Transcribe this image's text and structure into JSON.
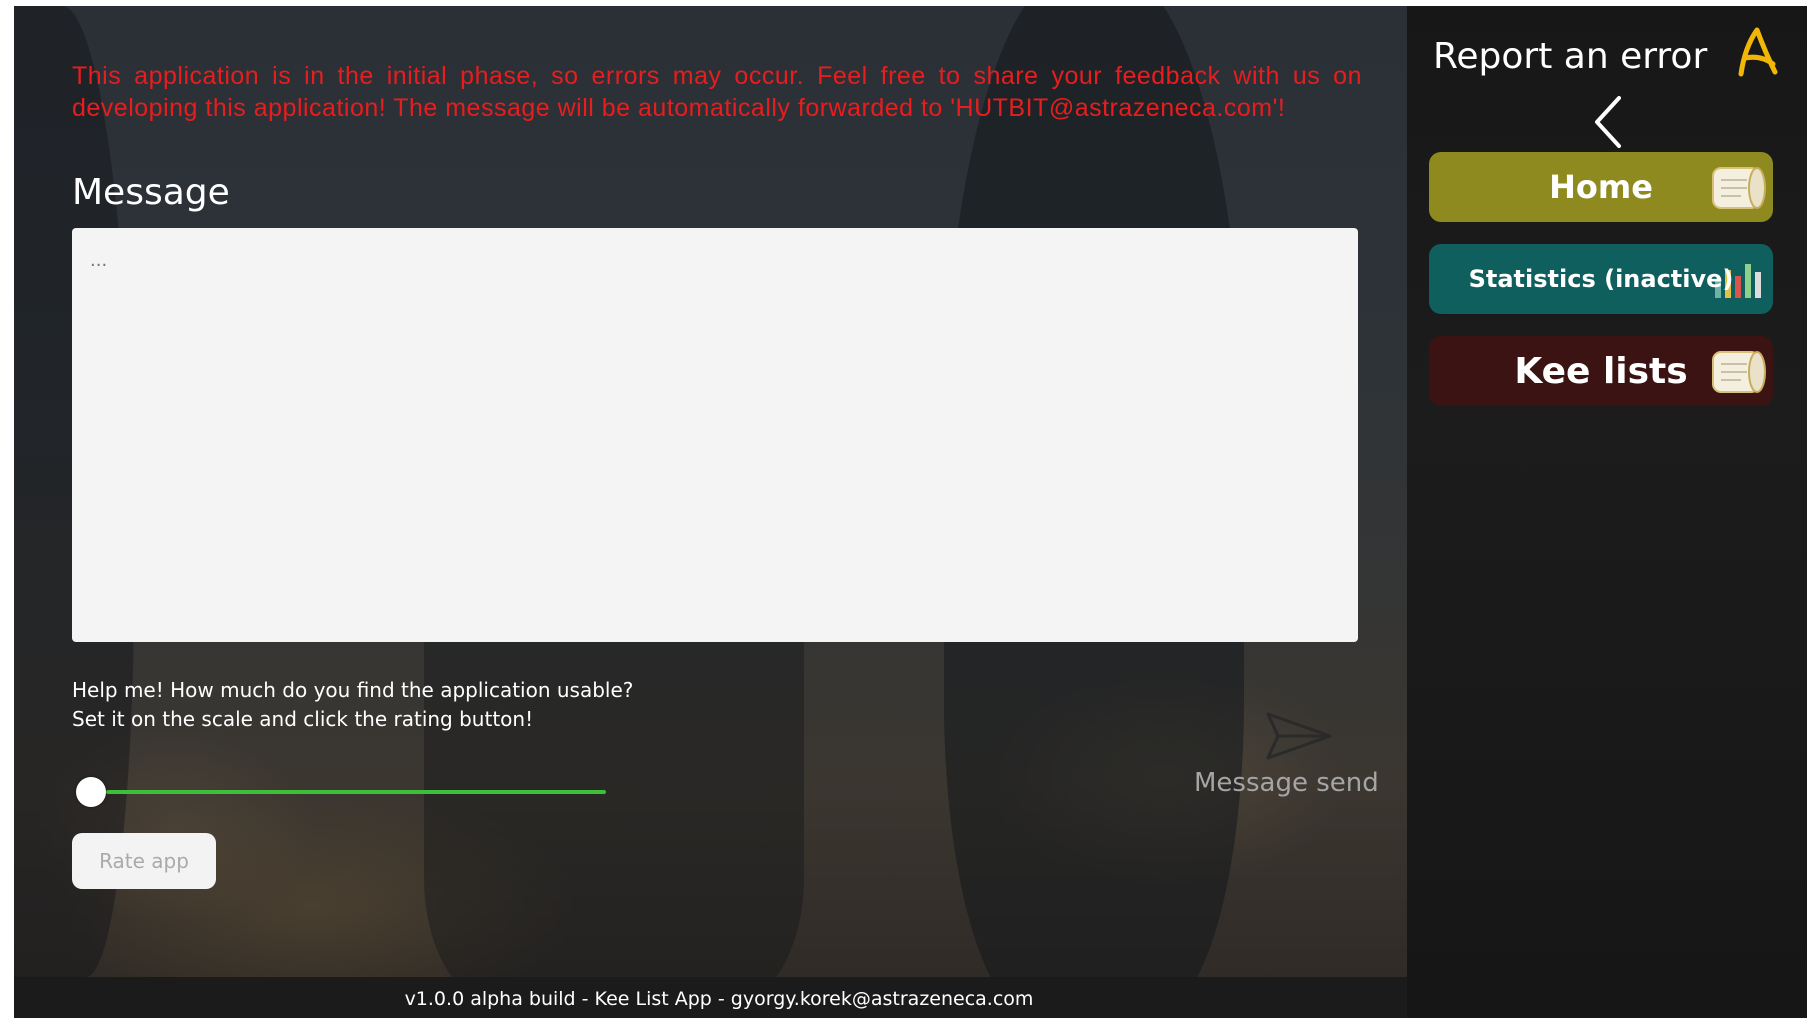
{
  "main": {
    "warning": "This application is in the initial phase, so errors may occur. Feel free to share your feedback with us on developing this application! The message will be automatically forwarded to 'HUTBIT@astrazeneca.com'!",
    "message_label": "Message",
    "message_placeholder": "...",
    "help_line1": "Help me! How much do you find the application usable?",
    "help_line2": "Set it on the scale and click the rating button!",
    "rating_value": 0,
    "rate_button": "Rate app",
    "send_label": "Message send"
  },
  "sidebar": {
    "title": "Report an error",
    "nav": [
      {
        "label": "Home",
        "color": "#8f8a1f"
      },
      {
        "label": "Statistics (inactive)",
        "color": "#0f5f5e"
      },
      {
        "label": "Kee lists",
        "color": "#3a1312"
      }
    ]
  },
  "footer": {
    "text": "v1.0.0 alpha build - Kee List App - gyorgy.korek@astrazeneca.com"
  },
  "colors": {
    "warning": "#e81d1d",
    "slider": "#3dbf3a",
    "accent_logo": "#f2b705"
  }
}
